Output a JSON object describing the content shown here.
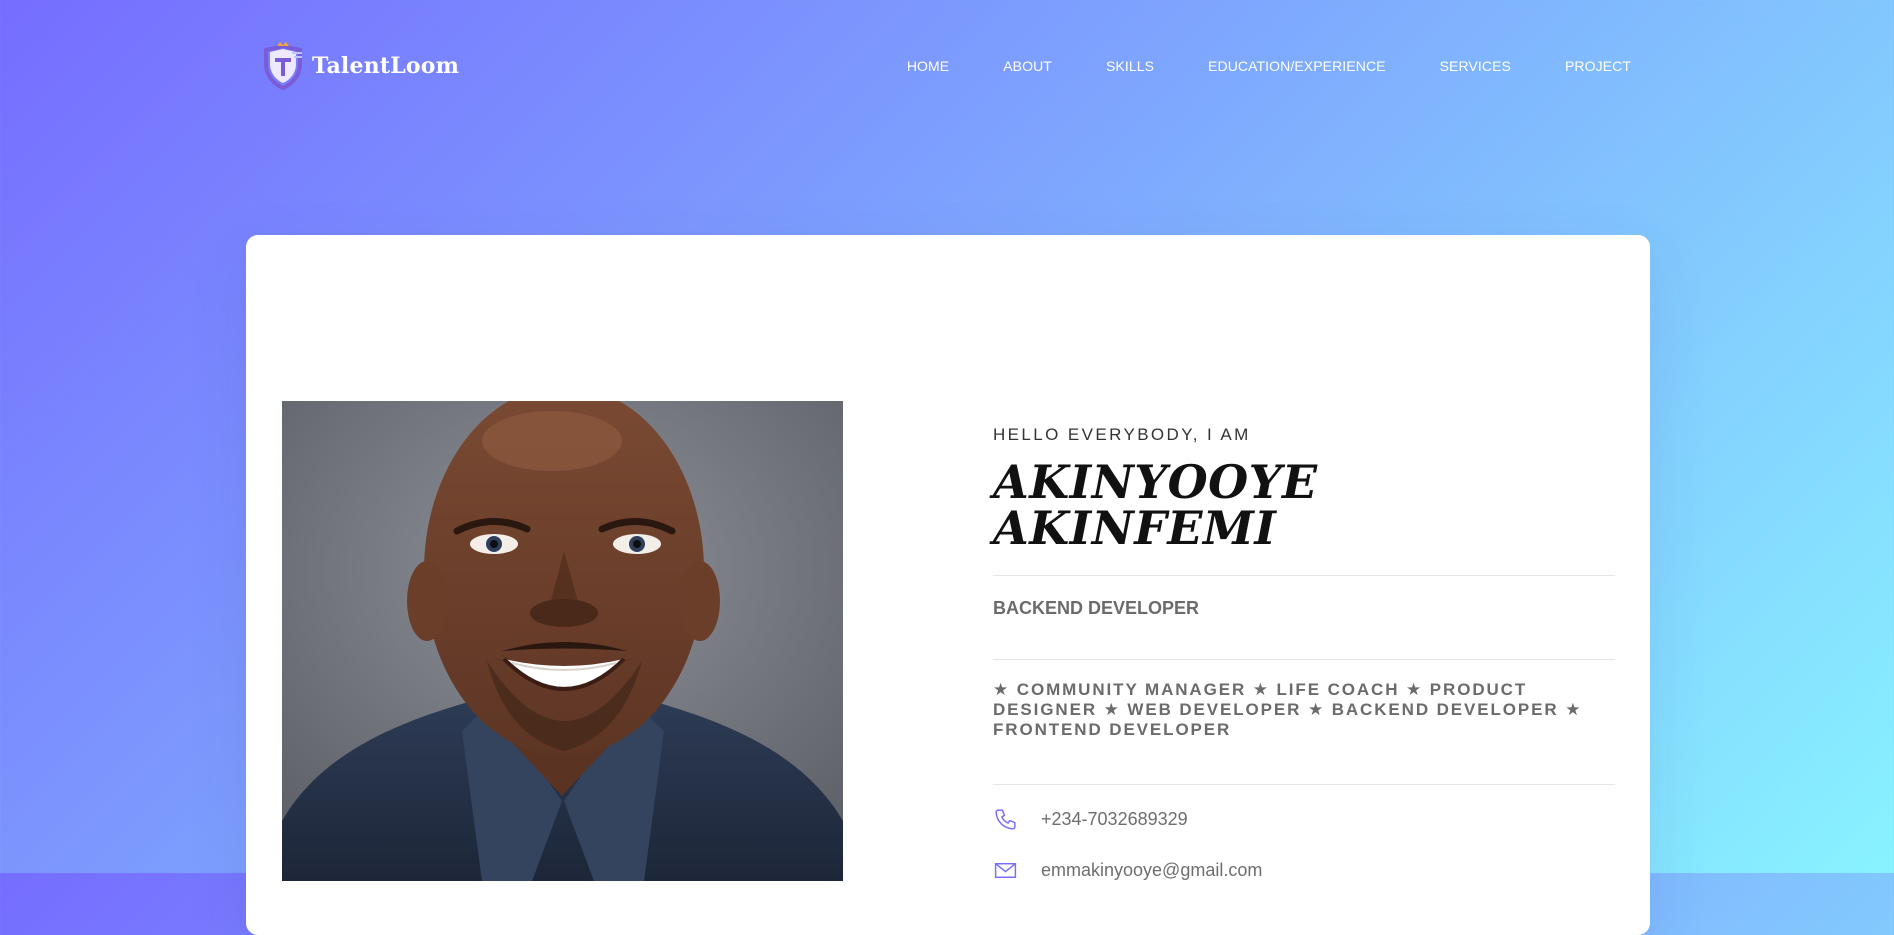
{
  "brand": {
    "name": "TalentLoom",
    "accent": "#766dff",
    "gradient_end": "#88f3ff"
  },
  "nav": {
    "items": [
      {
        "label": "HOME"
      },
      {
        "label": "ABOUT"
      },
      {
        "label": "SKILLS"
      },
      {
        "label": "EDUCATION/EXPERIENCE"
      },
      {
        "label": "SERVICES"
      },
      {
        "label": "PROJECT"
      }
    ]
  },
  "profile": {
    "greeting": "HELLO EVERYBODY, I AM",
    "name": "AKINYOOYE AKINFEMI",
    "role": "BACKEND DEVELOPER",
    "tags": "★ COMMUNITY MANAGER ★ LIFE COACH ★ PRODUCT DESIGNER ★ WEB DEVELOPER ★ BACKEND DEVELOPER ★ FRONTEND DEVELOPER",
    "phone": "+234-7032689329",
    "email": "emmakinyooye@gmail.com"
  },
  "icons": {
    "logo": "shield-t-icon",
    "phone": "phone-icon",
    "email": "envelope-icon"
  }
}
